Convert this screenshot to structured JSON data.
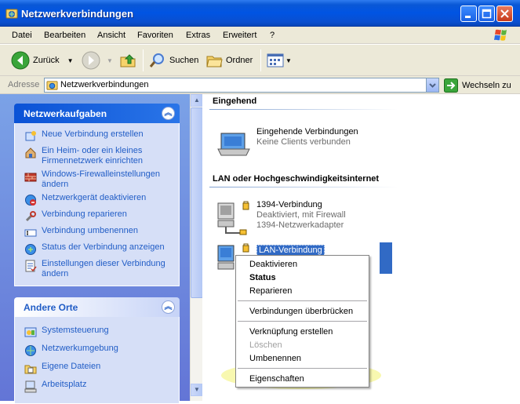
{
  "window": {
    "title": "Netzwerkverbindungen",
    "icon": "network-folder-icon",
    "controls": [
      "minimize-icon",
      "maximize-icon",
      "close-icon"
    ]
  },
  "menubar": {
    "items": [
      "Datei",
      "Bearbeiten",
      "Ansicht",
      "Favoriten",
      "Extras",
      "Erweitert",
      "?"
    ]
  },
  "toolbar": {
    "back_label": "Zurück",
    "search_label": "Suchen",
    "folders_label": "Ordner"
  },
  "address": {
    "label": "Adresse",
    "value": "Netzwerkverbindungen",
    "go_label": "Wechseln zu"
  },
  "left_pane": {
    "network_tasks": {
      "title": "Netzwerkaufgaben",
      "items": [
        {
          "label": "Neue Verbindung erstellen",
          "icon": "new-connection-icon"
        },
        {
          "label": "Ein Heim- oder ein kleines Firmennetzwerk einrichten",
          "icon": "home-network-icon"
        },
        {
          "label": "Windows-Firewalleinstellungen ändern",
          "icon": "firewall-icon"
        },
        {
          "label": "Netzwerkgerät deaktivieren",
          "icon": "disable-device-icon"
        },
        {
          "label": "Verbindung reparieren",
          "icon": "repair-icon"
        },
        {
          "label": "Verbindung umbenennen",
          "icon": "rename-icon"
        },
        {
          "label": "Status der Verbindung anzeigen",
          "icon": "status-icon"
        },
        {
          "label": "Einstellungen dieser Verbindung ändern",
          "icon": "settings-icon"
        }
      ]
    },
    "other_places": {
      "title": "Andere Orte",
      "items": [
        {
          "label": "Systemsteuerung",
          "icon": "control-panel-icon"
        },
        {
          "label": "Netzwerkumgebung",
          "icon": "network-places-icon"
        },
        {
          "label": "Eigene Dateien",
          "icon": "my-documents-icon"
        },
        {
          "label": "Arbeitsplatz",
          "icon": "my-computer-icon"
        }
      ]
    }
  },
  "main": {
    "groups": [
      {
        "title": "Eingehend",
        "connections": [
          {
            "name": "Eingehende Verbindungen",
            "line2": "Keine Clients verbunden",
            "line3": ""
          }
        ]
      },
      {
        "title": "LAN oder Hochgeschwindigkeitsinternet",
        "connections": [
          {
            "name": "1394-Verbindung",
            "line2": "Deaktiviert, mit Firewall",
            "line3": "1394-Netzwerkadapter"
          },
          {
            "name": "LAN-Verbindung",
            "line2": "",
            "line3": ""
          }
        ]
      }
    ]
  },
  "context_menu": {
    "items": [
      {
        "label": "Deaktivieren",
        "style": "normal"
      },
      {
        "label": "Status",
        "style": "bold"
      },
      {
        "label": "Reparieren",
        "style": "normal"
      },
      {
        "label": "Verbindungen überbrücken",
        "style": "normal"
      },
      {
        "label": "Verknüpfung erstellen",
        "style": "normal"
      },
      {
        "label": "Löschen",
        "style": "disabled"
      },
      {
        "label": "Umbenennen",
        "style": "normal"
      },
      {
        "label": "Eigenschaften",
        "style": "normal"
      }
    ],
    "highlighted_item": "Eigenschaften",
    "highlight_color": "#f0f050"
  },
  "colors": {
    "title_bar": "#0054e3",
    "task_link": "#215dc6",
    "panel_body": "#d6dff7",
    "selection": "#316ac5"
  }
}
